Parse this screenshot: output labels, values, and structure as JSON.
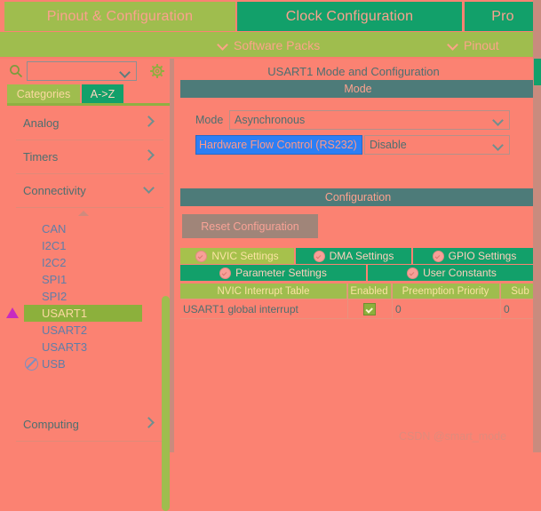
{
  "top_tabs": [
    {
      "label": "Pinout & Configuration",
      "active": true
    },
    {
      "label": "Clock Configuration",
      "active": false
    },
    {
      "label": "Pro",
      "active": false
    }
  ],
  "menu": {
    "software_packs": "Software Packs",
    "pinout": "Pinout"
  },
  "sidebar": {
    "search": {
      "value": "",
      "placeholder": ""
    },
    "icons": {
      "search": "search-icon",
      "gear": "gear-icon",
      "chevron": "chevron-down-icon"
    },
    "tabs": [
      {
        "label": "Categories",
        "active": true
      },
      {
        "label": "A->Z",
        "active": false
      }
    ],
    "groups": [
      {
        "label": "Analog",
        "expanded": false
      },
      {
        "label": "Timers",
        "expanded": false
      },
      {
        "label": "Connectivity",
        "expanded": true
      }
    ],
    "peripherals": [
      {
        "label": "CAN",
        "selected": false,
        "icon": "none"
      },
      {
        "label": "I2C1",
        "selected": false,
        "icon": "none"
      },
      {
        "label": "I2C2",
        "selected": false,
        "icon": "none"
      },
      {
        "label": "SPI1",
        "selected": false,
        "icon": "none"
      },
      {
        "label": "SPI2",
        "selected": false,
        "icon": "none"
      },
      {
        "label": "USART1",
        "selected": true,
        "icon": "warning-triangle-icon"
      },
      {
        "label": "USART2",
        "selected": false,
        "icon": "none"
      },
      {
        "label": "USART3",
        "selected": false,
        "icon": "none"
      },
      {
        "label": "USB",
        "selected": false,
        "icon": "not-allowed-icon"
      }
    ],
    "bottom_group": {
      "label": "Computing",
      "expanded": false
    }
  },
  "main": {
    "panel_title": "USART1 Mode and Configuration",
    "mode_section": {
      "header": "Mode",
      "mode_label": "Mode",
      "mode_value": "Asynchronous",
      "flow_control_label": "Hardware Flow Control (RS232)",
      "flow_control_value": "Disable"
    },
    "configuration_section": {
      "header": "Configuration",
      "reset_button": "Reset Configuration",
      "tabs_row1": [
        {
          "label": "NVIC Settings",
          "active": true
        },
        {
          "label": "DMA Settings",
          "active": false
        },
        {
          "label": "GPIO Settings",
          "active": false
        }
      ],
      "tabs_row2": [
        {
          "label": "Parameter Settings",
          "active": false
        },
        {
          "label": "User Constants",
          "active": false
        }
      ],
      "table": {
        "columns": [
          "NVIC Interrupt Table",
          "Enabled",
          "Preemption Priority",
          "Sub"
        ],
        "rows": [
          {
            "name": "USART1 global interrupt",
            "enabled": true,
            "preemption_priority": "0",
            "sub_priority": "0"
          }
        ]
      }
    }
  },
  "watermark": "CSDN @smart_mode",
  "colors": {
    "background": "#fb8272",
    "accent_green": "#9fbd4e",
    "tab_green": "#12a06a",
    "section_teal": "#4d7b79",
    "highlight_blue": "#2c7ff5",
    "warning_magenta": "#c82ac0"
  }
}
